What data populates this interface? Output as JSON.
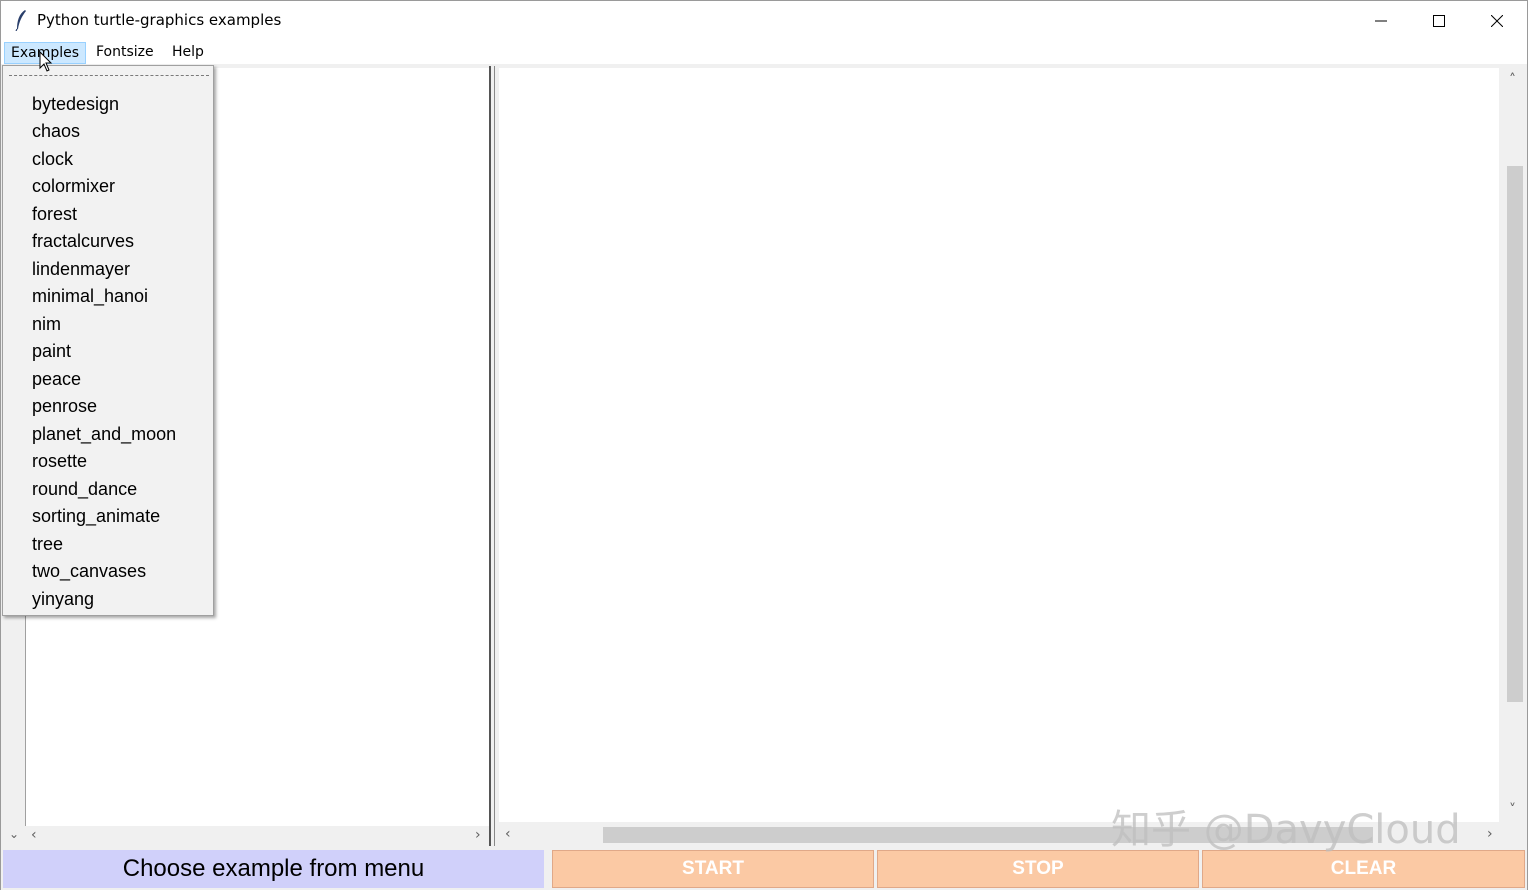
{
  "window": {
    "title": "Python turtle-graphics examples",
    "icon": "feather-icon",
    "controls": [
      "minimize-icon",
      "maximize-icon",
      "close-icon"
    ]
  },
  "menubar": {
    "items": [
      {
        "label": "Examples",
        "active": true
      },
      {
        "label": "Fontsize",
        "active": false
      },
      {
        "label": "Help",
        "active": false
      }
    ]
  },
  "examples_menu": {
    "items": [
      "bytedesign",
      "chaos",
      "clock",
      "colormixer",
      "forest",
      "fractalcurves",
      "lindenmayer",
      "minimal_hanoi",
      "nim",
      "paint",
      "peace",
      "penrose",
      "planet_and_moon",
      "rosette",
      "round_dance",
      "sorting_animate",
      "tree",
      "two_canvases",
      "yinyang"
    ]
  },
  "bottom": {
    "status": "Choose example from menu",
    "start_label": "START",
    "stop_label": "STOP",
    "clear_label": "CLEAR"
  },
  "watermark": "知乎 @DavyCloud",
  "colors": {
    "status_bg": "#d0d0fa",
    "button_bg": "#fbc9a4",
    "menu_active": "#cce8ff"
  }
}
